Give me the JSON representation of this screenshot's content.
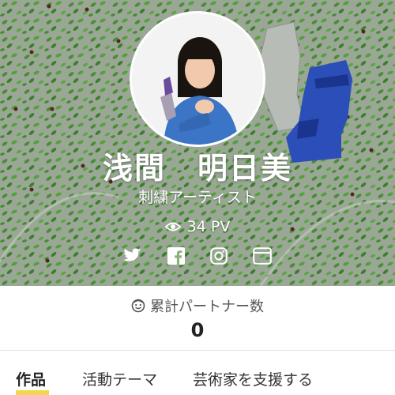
{
  "profile": {
    "name": "浅間　明日美",
    "title": "刺繍アーティスト",
    "page_views": "34 PV"
  },
  "social_links": [
    {
      "icon": "twitter-icon"
    },
    {
      "icon": "facebook-icon"
    },
    {
      "icon": "instagram-icon"
    },
    {
      "icon": "website-icon"
    }
  ],
  "supporters": {
    "label": "累計パートナー数",
    "count": "0"
  },
  "tabs": [
    {
      "label": "作品",
      "active": true
    },
    {
      "label": "活動テーマ",
      "active": false
    },
    {
      "label": "芸術家を支援する",
      "active": false
    }
  ],
  "colors": {
    "accent": "#f2d64b",
    "hero_green": "#8fb07a",
    "moai_blue": "#2f55c8"
  }
}
